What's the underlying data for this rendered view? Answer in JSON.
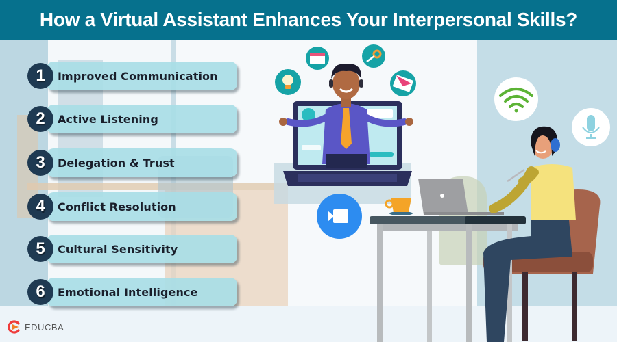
{
  "header": {
    "title": "How a Virtual Assistant Enhances Your Interpersonal Skills?"
  },
  "skills": [
    {
      "number": "1",
      "label": "Improved Communication"
    },
    {
      "number": "2",
      "label": "Active Listening"
    },
    {
      "number": "3",
      "label": "Delegation & Trust"
    },
    {
      "number": "4",
      "label": "Conflict Resolution"
    },
    {
      "number": "5",
      "label": "Cultural Sensitivity"
    },
    {
      "number": "6",
      "label": "Emotional Intelligence"
    }
  ],
  "brand": {
    "name": "EDUCBA"
  },
  "illustration": {
    "floating_icons": [
      "lightbulb-icon",
      "calendar-icon",
      "key-icon",
      "envelope-icon",
      "wifi-icon",
      "microphone-icon",
      "video-camera-icon"
    ]
  },
  "colors": {
    "header_bg": "#06718d",
    "pill_bg": "#a8dde6",
    "badge_bg": "#1f3a52",
    "accent_teal": "#17a5a8",
    "video_blue": "#2d8cf0"
  }
}
